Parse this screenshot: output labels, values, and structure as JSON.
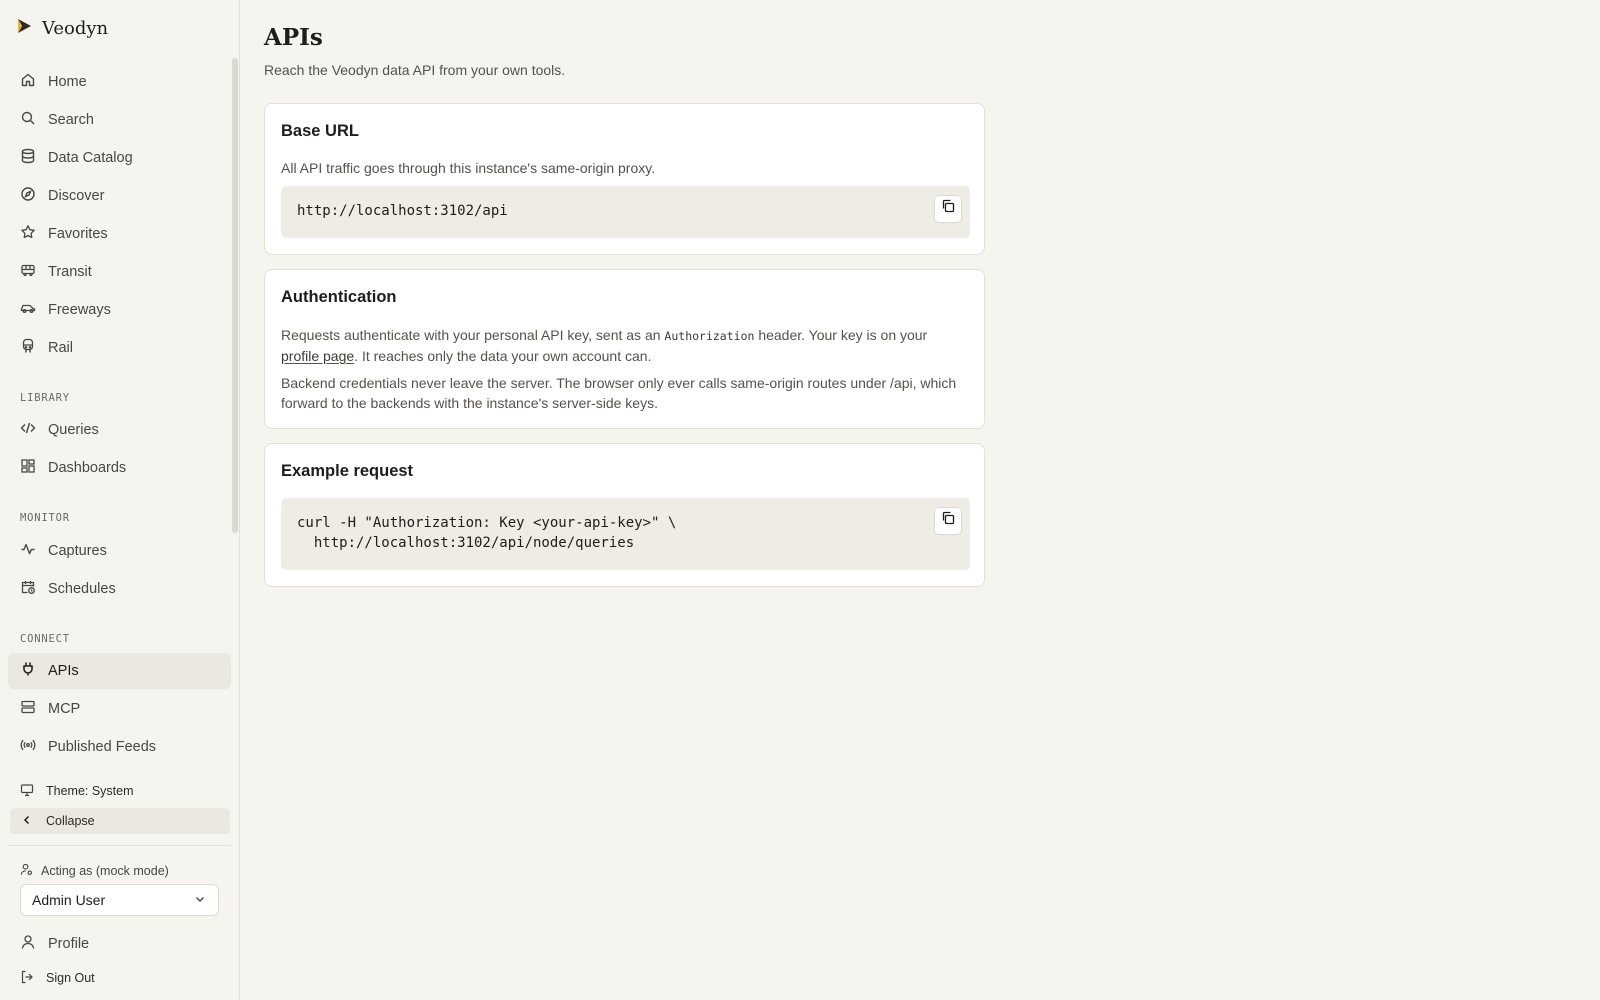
{
  "brand": {
    "name": "Veodyn"
  },
  "nav": {
    "main": [
      {
        "label": "Home",
        "icon": "home-icon"
      },
      {
        "label": "Search",
        "icon": "search-icon"
      },
      {
        "label": "Data Catalog",
        "icon": "database-icon"
      },
      {
        "label": "Discover",
        "icon": "compass-icon"
      },
      {
        "label": "Favorites",
        "icon": "star-icon"
      },
      {
        "label": "Transit",
        "icon": "bus-icon"
      },
      {
        "label": "Freeways",
        "icon": "car-icon"
      },
      {
        "label": "Rail",
        "icon": "train-icon"
      }
    ],
    "library_label": "LIBRARY",
    "library": [
      {
        "label": "Queries",
        "icon": "code-icon"
      },
      {
        "label": "Dashboards",
        "icon": "dashboard-icon"
      }
    ],
    "monitor_label": "MONITOR",
    "monitor": [
      {
        "label": "Captures",
        "icon": "activity-icon"
      },
      {
        "label": "Schedules",
        "icon": "calendar-clock-icon"
      }
    ],
    "connect_label": "CONNECT",
    "connect": [
      {
        "label": "APIs",
        "icon": "plug-icon",
        "active": true
      },
      {
        "label": "MCP",
        "icon": "server-icon"
      },
      {
        "label": "Published Feeds",
        "icon": "radio-icon"
      }
    ]
  },
  "footer": {
    "theme_label": "Theme: System",
    "collapse_label": "Collapse",
    "acting_label": "Acting as (mock mode)",
    "acting_user": "Admin User",
    "profile_label": "Profile",
    "signout_label": "Sign Out"
  },
  "page": {
    "title": "APIs",
    "subtitle": "Reach the Veodyn data API from your own tools."
  },
  "base_url": {
    "title": "Base URL",
    "description": "All API traffic goes through this instance's same-origin proxy.",
    "url": "http://localhost:3102/api"
  },
  "auth": {
    "title": "Authentication",
    "p1_a": "Requests authenticate with your personal API key, sent as an ",
    "p1_code": "Authorization",
    "p1_b": " header. Your key is on your ",
    "p1_link": "profile page",
    "p1_c": ". It reaches only the data your own account can.",
    "p2": "Backend credentials never leave the server. The browser only ever calls same-origin routes under /api, which forward to the backends with the instance's server-side keys."
  },
  "example": {
    "title": "Example request",
    "line1": "curl -H \"Authorization: Key <your-api-key>\" \\",
    "line2": "  http://localhost:3102/api/node/queries"
  }
}
